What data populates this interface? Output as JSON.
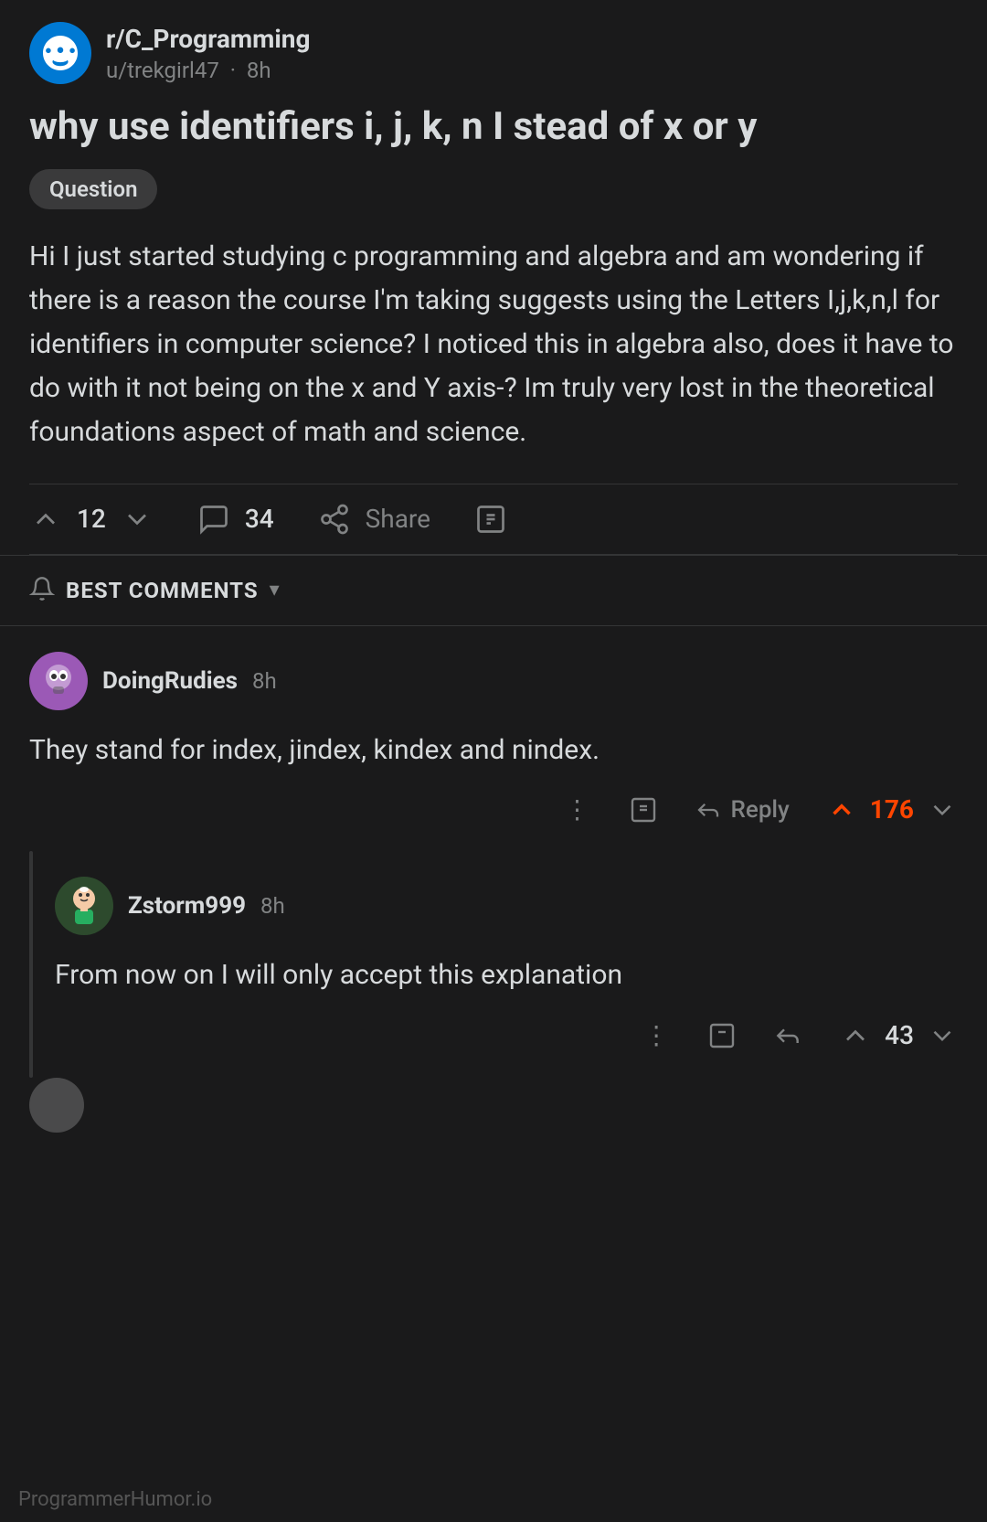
{
  "post": {
    "subreddit": "r/C_Programming",
    "author": "u/trekgirl47",
    "time": "8h",
    "title": "why use identifiers i, j, k, n I stead of x or y",
    "flair": "Question",
    "body": "Hi I just started studying c programming and algebra and am wondering if there is a reason the course I'm taking suggests using the Letters I,j,k,n,l for identifiers in computer science?  I noticed this in algebra also, does it have to do with it not being on the x and Y axis-?  Im truly very lost in the theoretical foundations aspect of math and science.",
    "upvotes": "12",
    "comments": "34",
    "share_label": "Share"
  },
  "sort": {
    "label": "BEST COMMENTS",
    "chevron": "▾"
  },
  "comments": [
    {
      "id": "1",
      "username": "DoingRudies",
      "time": "8h",
      "body": "They stand for index, jindex, kindex and nindex.",
      "upvotes": "176",
      "reply_label": "Reply"
    }
  ],
  "nested_comments": [
    {
      "id": "1-1",
      "username": "Zstorm999",
      "time": "8h",
      "body": "From now on I will only accept this explanation",
      "upvotes": "43",
      "reply_label": "Reply"
    }
  ],
  "watermark": "ProgrammerHumor.io",
  "icons": {
    "upvote": "upvote-icon",
    "downvote": "downvote-icon",
    "comment": "comment-icon",
    "share": "share-icon",
    "save": "save-icon",
    "reply": "reply-icon",
    "more": "more-options-icon",
    "sort": "sort-icon"
  }
}
